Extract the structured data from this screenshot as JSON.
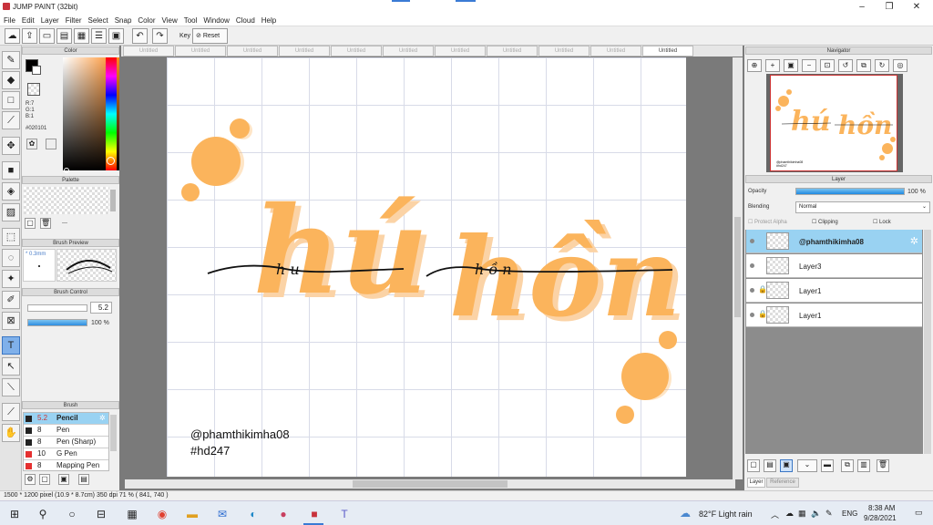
{
  "window": {
    "title": "JUMP PAINT (32bit)"
  },
  "menu": [
    "File",
    "Edit",
    "Layer",
    "Filter",
    "Select",
    "Snap",
    "Color",
    "View",
    "Tool",
    "Window",
    "Cloud",
    "Help"
  ],
  "toolbar": {
    "key_label": "Key",
    "reset_label": "Reset"
  },
  "color_panel": {
    "title": "Color",
    "r": "R:7",
    "g": "G:1",
    "b": "B:1",
    "hex": "#020101",
    "fg_color": "#020101"
  },
  "palette_panel": {
    "title": "Palette",
    "dash": "---"
  },
  "brush_preview": {
    "title": "Brush Preview",
    "size": "* 0.3mm"
  },
  "brush_control": {
    "title": "Brush Control",
    "size_value": "5.2",
    "opacity_value": "100 %",
    "opacity_level": 1.0
  },
  "brush_list": {
    "title": "Brush",
    "items": [
      {
        "size": "5.2",
        "name": "Pencil",
        "color": "#222222"
      },
      {
        "size": "8",
        "name": "Pen",
        "color": "#222222"
      },
      {
        "size": "8",
        "name": "Pen (Sharp)",
        "color": "#222222"
      },
      {
        "size": "10",
        "name": "G Pen",
        "color": "#e53030"
      },
      {
        "size": "8",
        "name": "Mapping Pen",
        "color": "#e53030"
      }
    ]
  },
  "tabs": [
    "Untitled",
    "Untitled",
    "Untitled",
    "Untitled",
    "Untitled",
    "Untitled",
    "Untitled",
    "Untitled",
    "Untitled",
    "Untitled",
    "Untitled"
  ],
  "canvas": {
    "handle_text": "@phamthikimha08",
    "hashtag_text": "#hd247",
    "words": [
      "hú",
      "hồn"
    ],
    "script_small_1": "h  u",
    "script_small_2": "h ồ n",
    "accent_color": "#fbb45c"
  },
  "navigator": {
    "title": "Navigator",
    "mini_handle": "@phamthikimha08",
    "mini_hash": "#hd247"
  },
  "layer_panel": {
    "title": "Layer",
    "opacity_label": "Opacity",
    "opacity_value": "100 %",
    "opacity_level": 1.0,
    "blending_label": "Blending",
    "blending_value": "Normal",
    "protect_alpha": "Protect Alpha",
    "clipping": "Clipping",
    "lock": "Lock",
    "layers": [
      "@phamthikimha08",
      "Layer3",
      "Layer1",
      "Layer1"
    ],
    "bottom_tabs": [
      "Layer",
      "Reference"
    ]
  },
  "status": {
    "text": "1500 * 1200 pixel   (10.9 * 8.7cm)   350 dpi   71 %   ( 841, 740 )"
  },
  "taskbar": {
    "weather": "82°F  Light rain",
    "lang": "ENG",
    "time": "8:38 AM",
    "date": "9/28/2021"
  }
}
